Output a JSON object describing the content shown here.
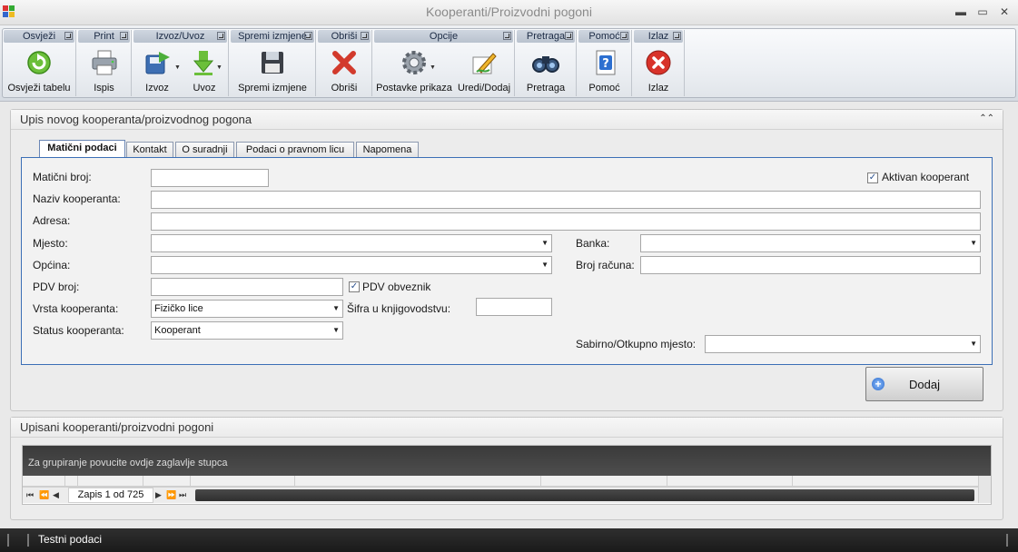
{
  "window": {
    "title": "Kooperanti/Proizvodni pogoni",
    "minimize": "▬",
    "maximize": "▭",
    "close": "✕"
  },
  "ribbon": {
    "groups": [
      {
        "title": "Osvježi",
        "buttons": [
          {
            "label": "Osvježi tabelu",
            "icon": "refresh-icon"
          }
        ]
      },
      {
        "title": "Print",
        "buttons": [
          {
            "label": "Ispis",
            "icon": "printer-icon"
          }
        ]
      },
      {
        "title": "Izvoz/Uvoz",
        "buttons": [
          {
            "label": "Izvoz",
            "icon": "export-icon"
          },
          {
            "label": "Uvoz",
            "icon": "import-icon"
          }
        ]
      },
      {
        "title": "Spremi izmjene",
        "buttons": [
          {
            "label": "Spremi izmjene",
            "icon": "save-icon"
          }
        ]
      },
      {
        "title": "Obriši",
        "buttons": [
          {
            "label": "Obriši",
            "icon": "delete-icon"
          }
        ]
      },
      {
        "title": "Opcije",
        "buttons": [
          {
            "label": "Postavke prikaza",
            "icon": "gear-icon"
          },
          {
            "label": "Uredi/Dodaj",
            "icon": "edit-icon"
          }
        ]
      },
      {
        "title": "Pretraga",
        "buttons": [
          {
            "label": "Pretraga",
            "icon": "binoculars-icon"
          }
        ]
      },
      {
        "title": "Pomoć",
        "buttons": [
          {
            "label": "Pomoć",
            "icon": "help-icon"
          }
        ]
      },
      {
        "title": "Izlaz",
        "buttons": [
          {
            "label": "Izlaz",
            "icon": "exit-icon"
          }
        ]
      }
    ]
  },
  "entry_panel": {
    "title": "Upis novog kooperanta/proizvodnog pogona",
    "tabs": [
      "Matični podaci",
      "Kontakt",
      "O suradnji",
      "Podaci o pravnom licu",
      "Napomena"
    ],
    "active_tab": "Matični podaci",
    "fields": {
      "maticni_broj": {
        "label": "Matični broj:",
        "value": ""
      },
      "aktivan": {
        "label": "Aktivan kooperant",
        "checked": true
      },
      "naziv": {
        "label": "Naziv kooperanta:",
        "value": ""
      },
      "adresa": {
        "label": "Adresa:",
        "value": ""
      },
      "mjesto": {
        "label": "Mjesto:",
        "value": ""
      },
      "banka": {
        "label": "Banka:",
        "value": ""
      },
      "opcina": {
        "label": "Općina:",
        "value": ""
      },
      "broj_racuna": {
        "label": "Broj računa:",
        "value": ""
      },
      "pdv_broj": {
        "label": "PDV broj:",
        "value": ""
      },
      "pdv_obveznik": {
        "label": "PDV obveznik",
        "checked": true
      },
      "vrsta": {
        "label": "Vrsta kooperanta:",
        "value": "Fizičko lice"
      },
      "sifra": {
        "label": "Šifra u knjigovodstvu:",
        "value": ""
      },
      "status": {
        "label": "Status kooperanta:",
        "value": "Kooperant"
      },
      "sabirno": {
        "label": "Sabirno/Otkupno mjesto:",
        "value": ""
      }
    },
    "add_button": "Dodaj"
  },
  "list_panel": {
    "title": "Upisani kooperanti/proizvodni pogoni",
    "group_hint": "Za grupiranje povucite ovdje zaglavlje stupca",
    "record_info": "Zapis 1 od 725"
  },
  "statusbar": {
    "text": "Testni podaci"
  }
}
